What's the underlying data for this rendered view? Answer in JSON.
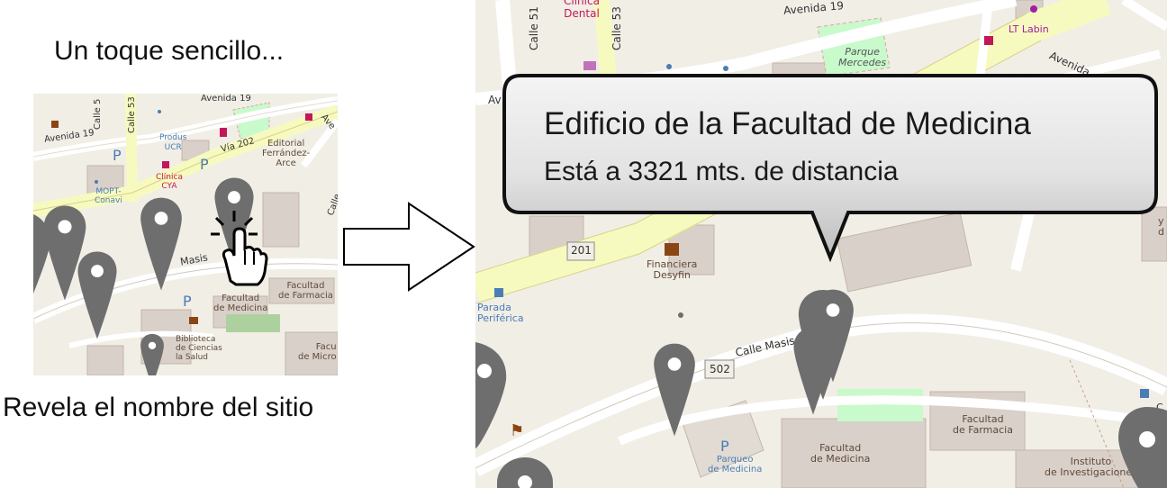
{
  "captions": {
    "top": "Un toque sencillo...",
    "bottom": "Revela el nombre del sitio"
  },
  "callout": {
    "title": "Edificio de la Facultad de Medicina",
    "subtitle": "Está a 3321 mts. de distancia"
  },
  "thumb_labels": {
    "avenida19": "Avenida 19",
    "calle5": "Calle 5",
    "calle53": "Calle 53",
    "avenida19_left": "Avenida 19",
    "produs": "Produs",
    "ucr": "UCR",
    "via202": "Vía 202",
    "editorial1": "Editorial",
    "editorial2": "Ferrández-",
    "editorial3": "Arce",
    "clinica1": "Clínica",
    "clinica2": "CYA",
    "mopt1": "MOPT-",
    "mopt2": "Conavi",
    "masis": "Masis",
    "facultad_med1": "Facultad",
    "facultad_med2": "de Medicina",
    "facultad_far1": "Facultad",
    "facultad_far2": "de Farmacia",
    "biblio1": "Biblioteca",
    "biblio2": "de Ciencias",
    "biblio3": "la Salud",
    "facu": "Facu",
    "micro": "de Micro",
    "calle_right": "Calle",
    "ave_top": "Ave"
  },
  "big_labels": {
    "clinica": "Clínica",
    "dental": "Dental",
    "calle51": "Calle 51",
    "calle53": "Calle 53",
    "avenida19": "Avenida 19",
    "parque1": "Parque",
    "parque2": "Mercedes",
    "lt_labin": "LT Labin",
    "avenida_right": "Avenida",
    "av_left": "Av",
    "route201": "201",
    "financiera1": "Financiera",
    "financiera2": "Desyfin",
    "parada1": "Parada",
    "parada2": "Periférica",
    "calle_masis": "Calle Masis",
    "route502": "502",
    "fac_farmacia1": "Facultad",
    "fac_farmacia2": "de Farmacia",
    "fac_medicina1": "Facultad",
    "fac_medicina2": "de Medicina",
    "parqueo_p": "P",
    "parqueo1": "Parqueo",
    "parqueo2": "de Medicina",
    "instituto1": "Instituto",
    "instituto2": "de Investigaciones",
    "y_right": "y",
    "d_right": "d",
    "c_right": "C"
  },
  "colors": {
    "main_road": "#f7fabf",
    "main_road_edge": "#d9d08a",
    "land": "#f1eee6",
    "building": "#d9d0c9",
    "building_edge": "#c4b6ab",
    "park": "#c8facc",
    "green_area": "#add19e",
    "pin": "#6e6e6e",
    "label_brown": "#5f4a3a",
    "label_blue": "#4a7cb6",
    "label_pink": "#c2185b",
    "callout_top": "#f4f4f4",
    "callout_bottom": "#bdbdbd"
  },
  "icons": [
    "pushpin-marker-icon",
    "hand-tap-icon",
    "right-arrow-icon",
    "parking-icon",
    "bus-stop-icon",
    "bank-icon",
    "pharmacy-icon",
    "library-icon"
  ]
}
